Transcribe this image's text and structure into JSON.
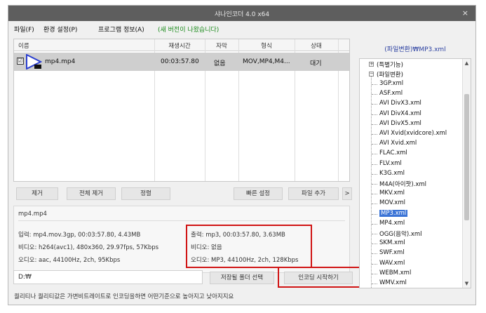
{
  "window": {
    "title": "샤나인코더 4.0 x64",
    "close_label": "×"
  },
  "menu": {
    "file": "파일(F)",
    "settings": "환경 설정(P)",
    "about": "프로그램 정보(A)",
    "notice": "(새 버전이 나왔습니다)"
  },
  "file_list": {
    "columns": [
      "이름",
      "재생시간",
      "자막",
      "형식",
      "상태"
    ],
    "rows": [
      {
        "name": "mp4.mp4",
        "duration": "00:03:57.80",
        "subtitle": "없음",
        "format": "MOV,MP4,M4...",
        "status": "대기",
        "checked": "☑"
      }
    ]
  },
  "icons": {
    "file_type": "video-file-icon",
    "tree_expander": "plus-minus-icon"
  },
  "buttons": {
    "remove": "제거",
    "remove_all": "전체 제거",
    "sort": "정렬",
    "quick_settings": "빠른 설정",
    "add_file": "파일 추가",
    "more": ">",
    "save_folder": "저장될 폴더 선택",
    "start_encoding": "인코딩 시작하기"
  },
  "info": {
    "filename": "mp4.mp4",
    "input": "입력: mp4.mov.3gp, 00:03:57.80, 4.43MB",
    "input_video": "비디오: h264(avc1), 480x360, 29.97fps, 57Kbps",
    "input_audio": "오디오: aac, 44100Hz, 2ch, 95Kbps",
    "output": "출력: mp3, 00:03:57.80, 3.63MB",
    "output_video": "비디오: 없음",
    "output_audio": "오디오: MP3, 44100Hz, 2ch, 128Kbps"
  },
  "output_path": "D:₩",
  "status_text": "퀄리티나 퀄리티값은 가변비트레이트로 인코딩을하면 어떤기준으로 높아지고 낮아지지요",
  "preset_panel": {
    "title": "(파일변환)₩MP3.xml",
    "root_items": [
      {
        "label": "(특별기능)",
        "expander": "+"
      },
      {
        "label": "(파일변환)",
        "expander": "−"
      }
    ],
    "items": [
      "3GP.xml",
      "ASF.xml",
      "AVI DivX3.xml",
      "AVI DivX4.xml",
      "AVI DivX5.xml",
      "AVI Xvid(xvidcore).xml",
      "AVI Xvid.xml",
      "FLAC.xml",
      "FLV.xml",
      "K3G.xml",
      "M4A(아이팟).xml",
      "MKV.xml",
      "MOV.xml",
      "MP3.xml",
      "MP4.xml",
      "OGG(음악).xml",
      "SKM.xml",
      "SWF.xml",
      "WAV.xml",
      "WEBM.xml",
      "WMV.xml"
    ],
    "selected": "MP3.xml"
  },
  "colors": {
    "titlebar": "#5e5e5e",
    "selection": "#3b74d6",
    "highlight": "#d01414",
    "notice": "#1a8a1a"
  }
}
